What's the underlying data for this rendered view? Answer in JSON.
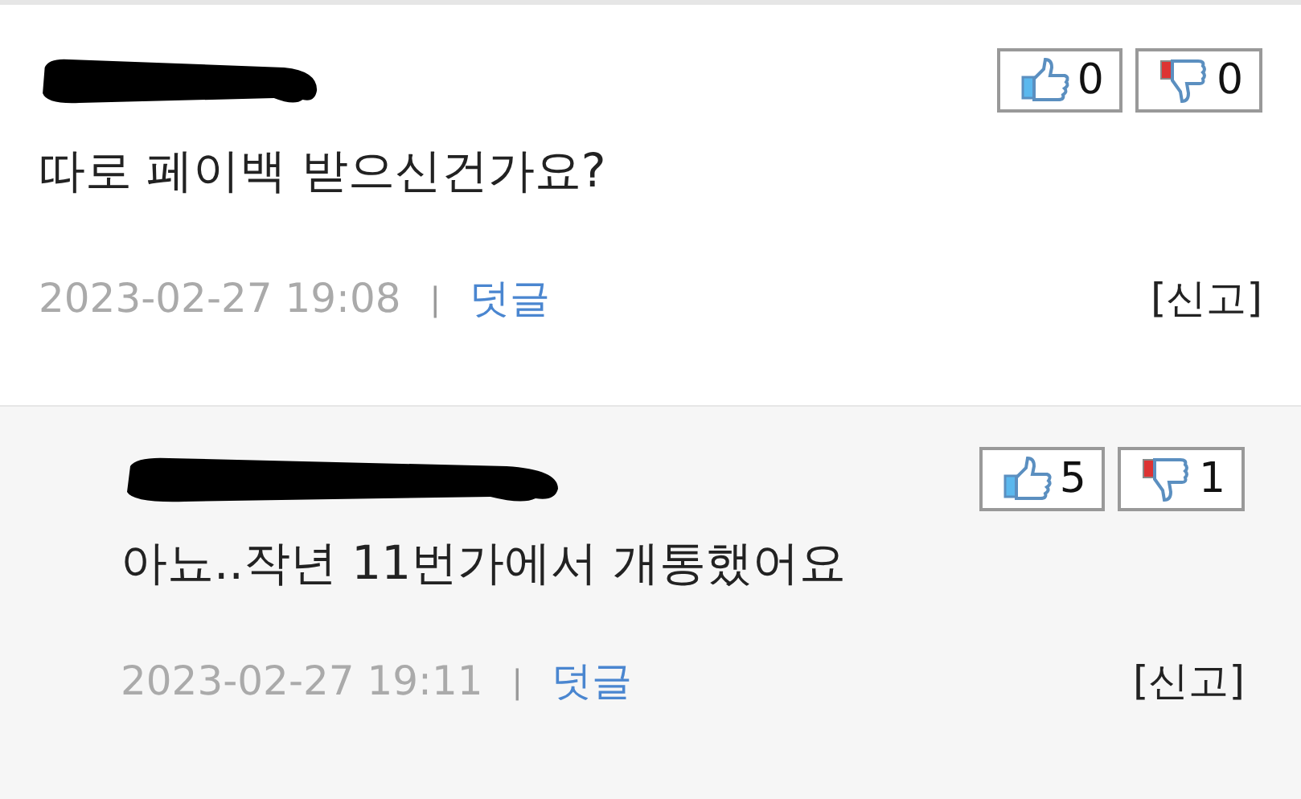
{
  "comments": [
    {
      "kind": "comment",
      "likes": "0",
      "dislikes": "0",
      "text": "따로 페이백 받으신건가요?",
      "date": "2023-02-27 19:08",
      "separator": "|",
      "reply_link": "덧글",
      "report": "[신고]"
    },
    {
      "kind": "reply",
      "likes": "5",
      "dislikes": "1",
      "text": "아뇨..작년 11번가에서 개통했어요",
      "date": "2023-02-27 19:11",
      "separator": "|",
      "reply_link": "덧글",
      "report": "[신고]"
    }
  ]
}
